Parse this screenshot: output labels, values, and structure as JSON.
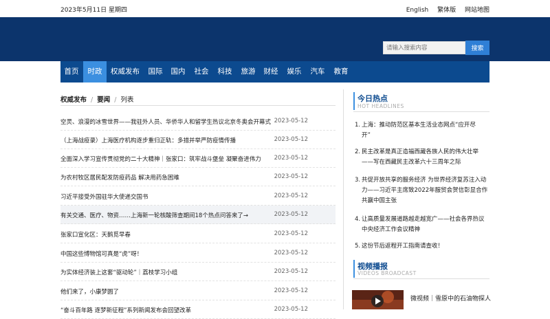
{
  "topbar": {
    "date": "2023年5月11日 星期四",
    "links": [
      "English",
      "繁体版",
      "网站地图"
    ]
  },
  "search": {
    "placeholder": "请输入搜索内容",
    "button": "搜索"
  },
  "nav": [
    "首页",
    "时政",
    "权威发布",
    "国际",
    "国内",
    "社会",
    "科技",
    "旅游",
    "财经",
    "娱乐",
    "汽车",
    "教育"
  ],
  "nav_active": "时政",
  "breadcrumb": [
    "权威发布",
    "要闻",
    "列表"
  ],
  "news": [
    {
      "title": "空灵、浪漫的冰雪世界——我驻外人员、华侨华人和留学生热议北京冬奥会开幕式",
      "date": "2023-05-12"
    },
    {
      "title": "（上海战疫录）上海医疗机构逐步重归正轨：多措并举严防疫情传播",
      "date": "2023-05-12"
    },
    {
      "title": "全面深入学习宣传贯彻党的二十大精神｜张家口：筑牢战斗堡垒 凝聚奋进伟力",
      "date": "2023-05-12"
    },
    {
      "title": "为农村牧区居民配发防疫药品 解决用药急困难",
      "date": "2023-05-12"
    },
    {
      "title": "习近平接受外国驻华大使递交国书",
      "date": "2023-05-12"
    },
    {
      "title": "有关交通、医疗、物资……上海新一轮核酸筛查期间18个热点问答来了→",
      "date": "2023-05-12"
    },
    {
      "title": "张家口宣化区：天鹅觅早春",
      "date": "2023-05-12"
    },
    {
      "title": "中国这些博物馆可真是“虎”呀！",
      "date": "2023-05-12"
    },
    {
      "title": "为实体经济装上这套“驱动轮”｜荔枝学习小组",
      "date": "2023-05-12"
    },
    {
      "title": "他们来了，小康梦圆了",
      "date": "2023-05-12"
    },
    {
      "title": "“奋斗百年路 逐梦新征程”系列新闻发布会回望改革",
      "date": "2023-05-12"
    }
  ],
  "hot": {
    "title": "今日热点",
    "subtitle": "HOT HEADLINES",
    "items": [
      {
        "num": "1.",
        "lines": [
          "上海：推动防范区基本生活业态网点“应开尽",
          "开”"
        ]
      },
      {
        "num": "2.",
        "lines": [
          "民主改革是真正造福西藏各族人民的伟大壮举",
          "——写在西藏民主改革六十三周年之际"
        ]
      },
      {
        "num": "3.",
        "lines": [
          "共促开放共享的服务经济 为世界经济复苏注入动",
          "力——习近平主席致2022年服贸会贺信彰显合作",
          "共赢中国主张"
        ]
      },
      {
        "num": "4.",
        "lines": [
          "让高质量发展道路越走越宽广——社会各界热议",
          "中央经济工作会议精神"
        ]
      },
      {
        "num": "5.",
        "lines": [
          "这份节后返程开工指南请查收！"
        ]
      }
    ]
  },
  "videos": {
    "title": "视频播报",
    "subtitle": "VIDEOS BROADCAST",
    "items": [
      {
        "title": "微视频｜雪原中的石油物探人"
      }
    ]
  },
  "colors": {
    "header": "#0c346c",
    "nav": "#0c4a8f",
    "nav_active": "#3b8fe0",
    "search_button": "#2f7fd6"
  }
}
